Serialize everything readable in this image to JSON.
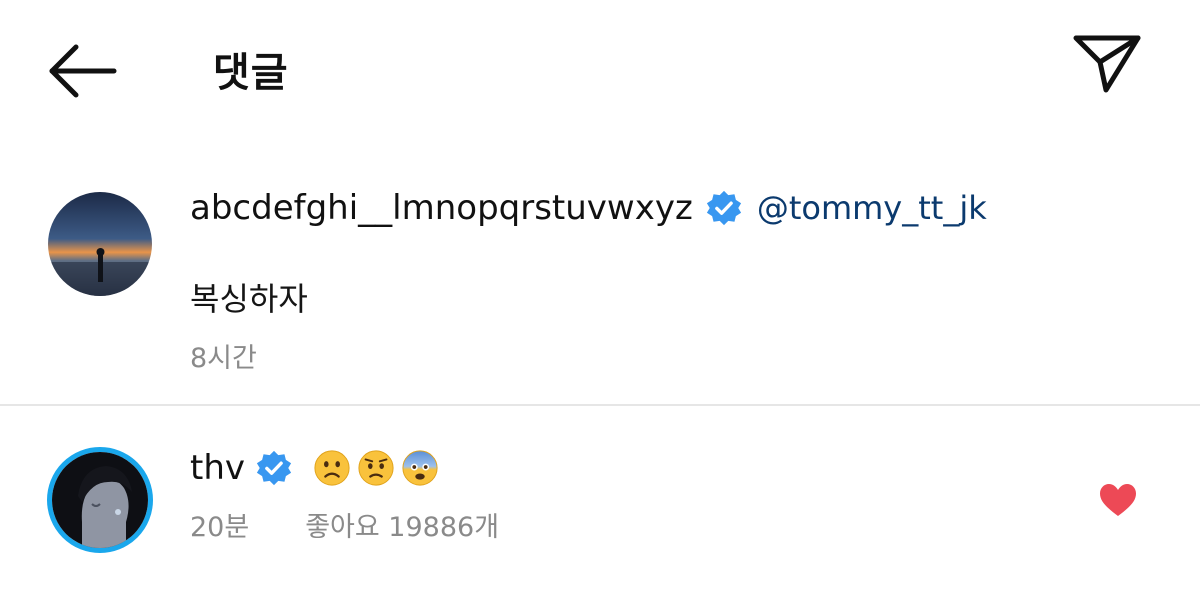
{
  "header": {
    "title": "댓글",
    "back_icon": "arrow-left-icon",
    "send_icon": "paper-plane-icon"
  },
  "comments": [
    {
      "username": "abcdefghi__lmnopqrstuvwxyz",
      "verified": true,
      "mention": "@tommy_tt_jk",
      "text": "복싱하자",
      "time": "8시간"
    },
    {
      "username": "thv",
      "verified": true,
      "emojis": [
        "frowning-face-emoji",
        "worried-face-emoji",
        "fearful-face-emoji"
      ],
      "time": "20분",
      "likes": "좋아요 19886개",
      "liked": true
    }
  ],
  "colors": {
    "verified": "#3897f0",
    "mention": "#0b3a6e",
    "meta": "#8a8a8a",
    "heart": "#ed4956",
    "avatar_ring": "#1aa7ec"
  }
}
